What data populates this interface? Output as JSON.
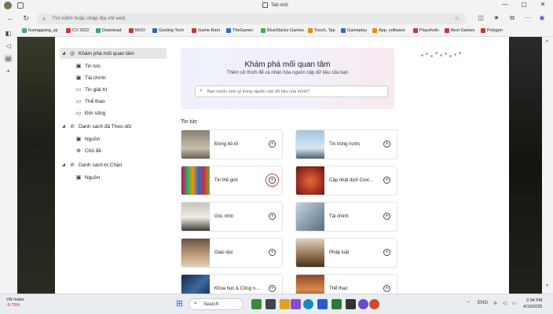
{
  "window": {
    "tab_title": "Tab mới"
  },
  "address_bar": {
    "placeholder": "Tìm kiếm hoặc nhập địa chỉ web"
  },
  "bookmarks": [
    {
      "label": "huonggiang_sp",
      "color": "#4a8"
    },
    {
      "label": "CV 2022",
      "color": "#c33"
    },
    {
      "label": "Download",
      "color": "#3a6"
    },
    {
      "label": "MUO",
      "color": "#c33"
    },
    {
      "label": "Guiding Tech",
      "color": "#36a"
    },
    {
      "label": "Game Rant",
      "color": "#c33"
    },
    {
      "label": "TheGamer",
      "color": "#36c"
    },
    {
      "label": "BlueStacks Games",
      "color": "#4a4"
    },
    {
      "label": "Touch, Tap",
      "color": "#e80"
    },
    {
      "label": "Gameplay",
      "color": "#36c"
    },
    {
      "label": "App, software",
      "color": "#e80"
    },
    {
      "label": "Playoholic",
      "color": "#c33"
    },
    {
      "label": "Best Games",
      "color": "#c33"
    },
    {
      "label": "Polygon",
      "color": "#c33"
    }
  ],
  "sidebar": {
    "groups": [
      {
        "label": "Khám phá mối quan tâm",
        "items": [
          "Tin tức",
          "Tài chính",
          "Tin giải trí",
          "Thể thao",
          "Đời sống"
        ]
      },
      {
        "label": "Danh sách đã Theo dõi",
        "items": [
          "Nguồn",
          "Chủ đề"
        ]
      },
      {
        "label": "Danh sách bị Chặn",
        "items": [
          "Nguồn"
        ]
      }
    ]
  },
  "hero": {
    "title": "Khám phá mối quan tâm",
    "subtitle": "Thêm sở thích để cá nhân hóa nguồn cấp dữ liệu của bạn",
    "search_placeholder": "Bạn muốn xem gì trong nguồn cấp dữ liệu của mình?"
  },
  "section_title": "Tin tức",
  "cards": [
    {
      "label": "Đừng bỏ lỡ",
      "thumb": "linear-gradient(180deg,#8a8070,#c8bfae 60%,#5a5248)"
    },
    {
      "label": "Tin trong nước",
      "thumb": "linear-gradient(180deg,#9fc4e0,#d7e8f4 60%,#3a4a5a)"
    },
    {
      "label": "Tin thế giới",
      "thumb": "linear-gradient(90deg,#d04,#2a7,#e90,#36c,#c33,#7a4)"
    },
    {
      "label": "Cập nhật dịch Covi...",
      "thumb": "radial-gradient(circle,#e86a3a,#a03020 60%,#5a1810)"
    },
    {
      "label": "Góc nhìn",
      "thumb": "linear-gradient(180deg,#c9c3b8,#f0ece4 50%,#2a2622)"
    },
    {
      "label": "Tài chính",
      "thumb": "linear-gradient(135deg,#c8d4dc,#8aa0b0 50%,#5a6a78)"
    },
    {
      "label": "Giáo dục",
      "thumb": "linear-gradient(180deg,#6a5040,#b89878 50%,#e8d8c0)"
    },
    {
      "label": "Pháp luật",
      "thumb": "linear-gradient(180deg,#dcd2c2,#8a6a4a 60%,#3a2a1a)"
    },
    {
      "label": "Khoa học & Công n...",
      "thumb": "linear-gradient(135deg,#1a2a4a,#3a6aa0 50%,#0a1428)"
    },
    {
      "label": "Thể thao",
      "thumb": "linear-gradient(180deg,#8a4a2a,#d88a4a 50%,#2a1a10)"
    }
  ],
  "taskbar": {
    "stock_name": "VN Index",
    "stock_change": "-6.76%",
    "search_label": "Search",
    "lang": "ENG",
    "time": "2:34 PM",
    "date": "4/10/2025"
  }
}
